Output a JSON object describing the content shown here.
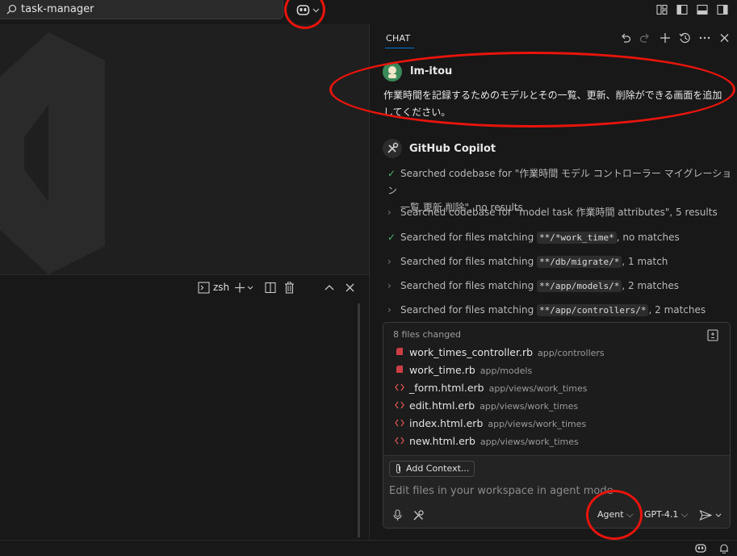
{
  "titlebar": {
    "search_text": "task-manager"
  },
  "terminal": {
    "shell_label": "zsh"
  },
  "chat": {
    "tab_label": "CHAT",
    "user": {
      "name": "lm-itou",
      "message_line1": "作業時間を記録するためのモデルとその一覧、更新、削除ができる画面を追加",
      "message_line2": "してください。"
    },
    "assistant": {
      "name": "GitHub Copilot"
    },
    "steps": [
      {
        "status": "done",
        "text_line1": "Searched codebase for \"作業時間 モデル コントローラー マイグレーション",
        "text_line2": "一覧 更新 削除\", no results"
      },
      {
        "status": "collapsed",
        "prefix": "Searched codebase for \"model task 作業時間 attributes\", 5 results"
      },
      {
        "status": "done",
        "prefix": "Searched for files matching ",
        "glob": "**/*work_time*",
        "suffix": ", no matches"
      },
      {
        "status": "collapsed",
        "prefix": "Searched for files matching ",
        "glob": "**/db/migrate/*",
        "suffix": ", 1 match"
      },
      {
        "status": "collapsed",
        "prefix": "Searched for files matching ",
        "glob": "**/app/models/*",
        "suffix": ", 2 matches"
      },
      {
        "status": "collapsed",
        "prefix": "Searched for files matching ",
        "glob": "**/app/controllers/*",
        "suffix": ", 2 matches"
      }
    ],
    "files_changed": {
      "header": "8 files changed",
      "files": [
        {
          "name": "work_times_controller.rb",
          "path": "app/controllers",
          "icon": "ruby-icon"
        },
        {
          "name": "work_time.rb",
          "path": "app/models",
          "icon": "ruby-icon"
        },
        {
          "name": "_form.html.erb",
          "path": "app/views/work_times",
          "icon": "code-icon"
        },
        {
          "name": "edit.html.erb",
          "path": "app/views/work_times",
          "icon": "code-icon"
        },
        {
          "name": "index.html.erb",
          "path": "app/views/work_times",
          "icon": "code-icon"
        },
        {
          "name": "new.html.erb",
          "path": "app/views/work_times",
          "icon": "code-icon"
        }
      ]
    },
    "input": {
      "add_context_label": "Add Context...",
      "placeholder": "Edit files in your workspace in agent mode",
      "mode_label": "Agent",
      "model_label": "GPT-4.1"
    }
  },
  "colors": {
    "accent": "#0078d4",
    "annotation": "#e8140c",
    "success": "#4fb36b",
    "ruby": "#cc3e44"
  }
}
